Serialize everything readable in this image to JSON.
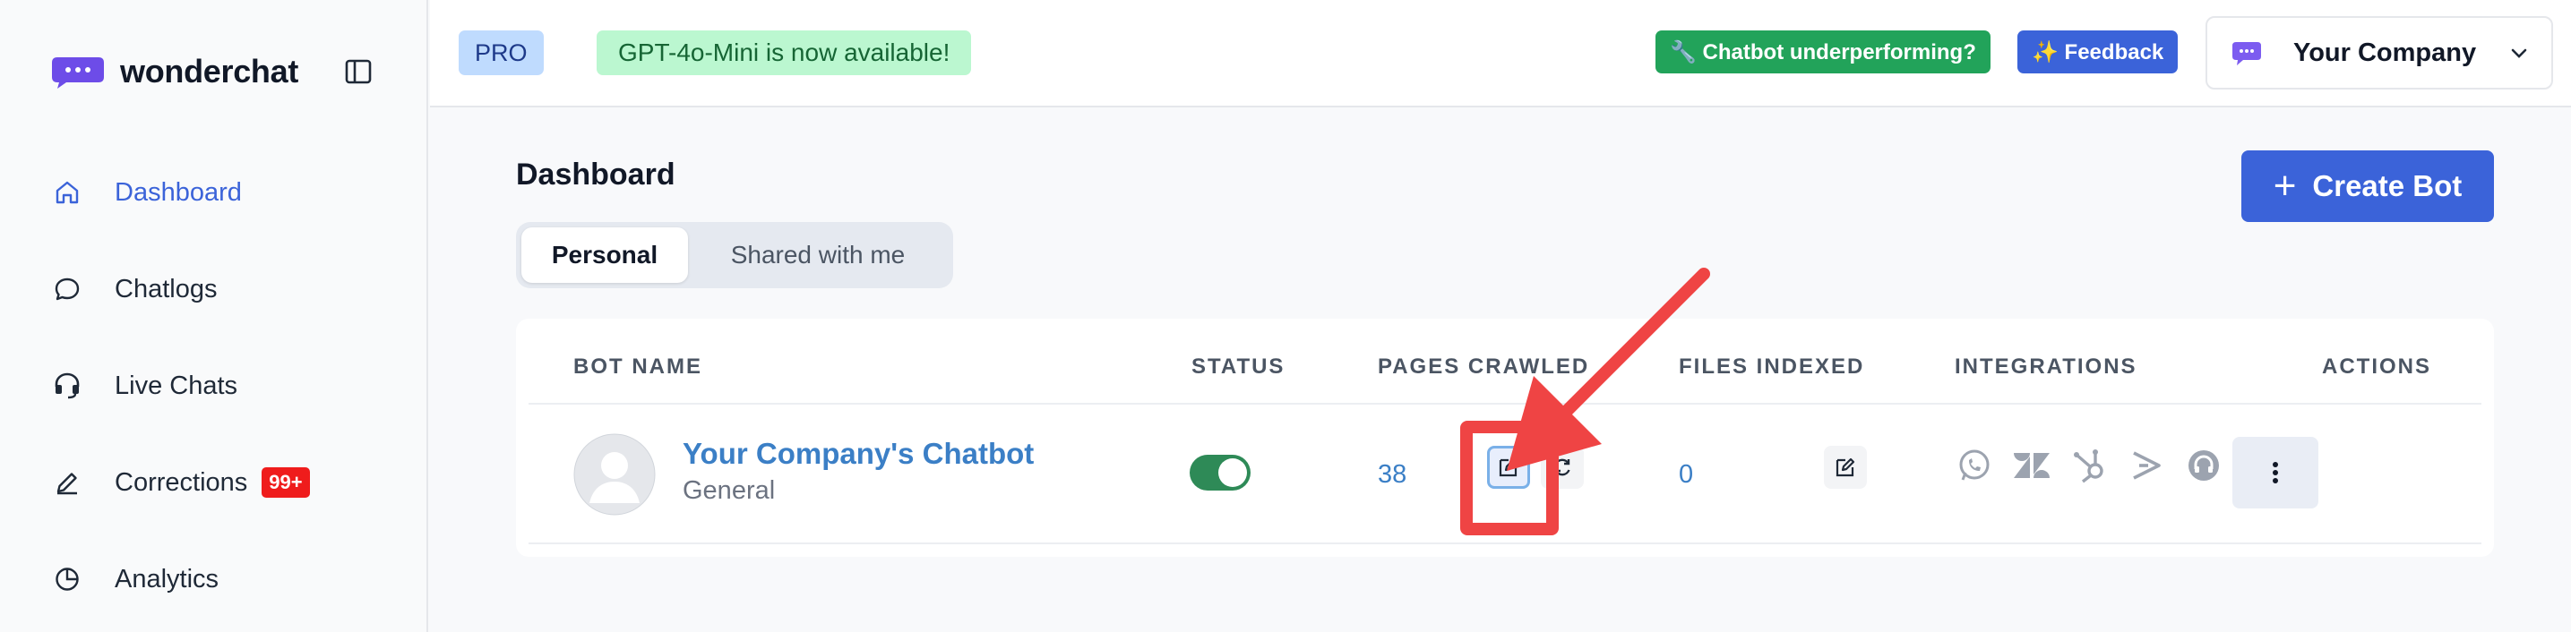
{
  "brand": {
    "name": "wonderchat"
  },
  "sidebar": {
    "items": [
      {
        "label": "Dashboard",
        "icon": "home-icon"
      },
      {
        "label": "Chatlogs",
        "icon": "chat-bubble-icon"
      },
      {
        "label": "Live Chats",
        "icon": "headset-icon"
      },
      {
        "label": "Corrections",
        "icon": "pen-icon",
        "badge": "99+"
      },
      {
        "label": "Analytics",
        "icon": "pie-chart-icon"
      }
    ]
  },
  "topbar": {
    "plan": "PRO",
    "announcement": "GPT-4o-Mini is now available!",
    "underperform_label": "🔧 Chatbot underperforming?",
    "feedback_label": "✨ Feedback",
    "company_name": "Your Company"
  },
  "page": {
    "title": "Dashboard",
    "tabs": [
      "Personal",
      "Shared with me"
    ],
    "create_label": "Create Bot"
  },
  "table": {
    "headers": [
      "BOT NAME",
      "STATUS",
      "PAGES CRAWLED",
      "FILES INDEXED",
      "INTEGRATIONS",
      "ACTIONS"
    ],
    "rows": [
      {
        "name": "Your Company's Chatbot",
        "category": "General",
        "status_on": true,
        "pages_crawled": "38",
        "files_indexed": "0",
        "integrations": [
          "whatsapp-icon",
          "zendesk-icon",
          "hubspot-icon",
          "forward-icon",
          "support-icon"
        ]
      }
    ]
  },
  "colors": {
    "accent": "#3b63d9",
    "link": "#3b7fc6",
    "toggle_on": "#2e8a57",
    "annotation": "#ef4444"
  }
}
